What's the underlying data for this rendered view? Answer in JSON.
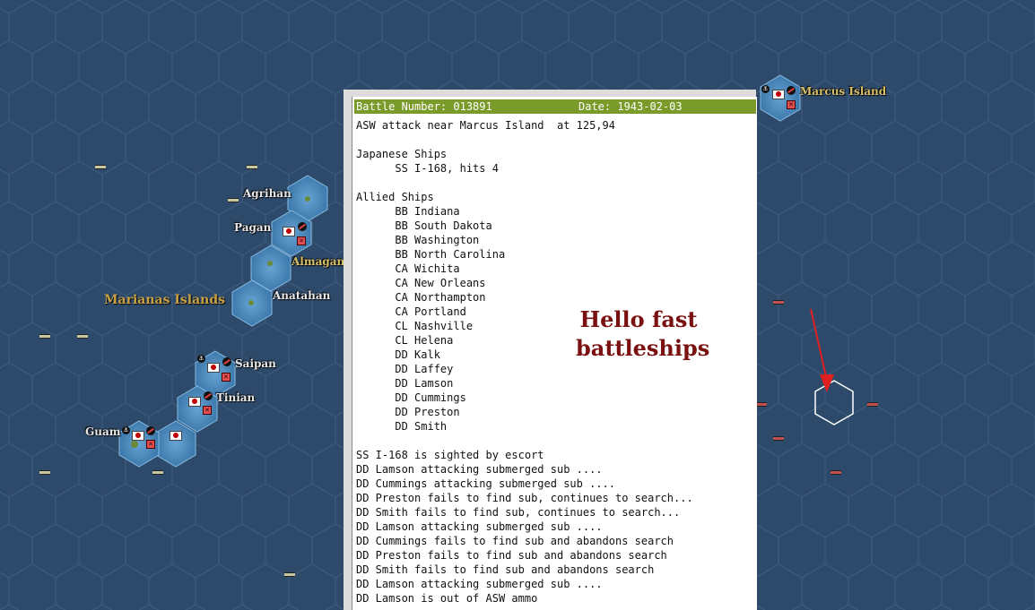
{
  "map": {
    "region_label": "Marianas Islands",
    "places": {
      "marcus": "Marcus Island",
      "agrihan": "Agrihan",
      "pagan": "Pagan",
      "almagan": "Almagan",
      "anatahan": "Anatahan",
      "saipan": "Saipan",
      "tinian": "Tinian",
      "guam": "Guam"
    },
    "colors": {
      "ocean": "#2e4a6b",
      "hex_line": "#3d5a7c",
      "highlight": "#5b98c8",
      "header_bar": "#7a9a2a",
      "annotation": "#7a1010"
    }
  },
  "report": {
    "battle_number": "Battle Number: 013891",
    "date": "Date: 1943-02-03",
    "lines": [
      "ASW attack near Marcus Island  at 125,94",
      "",
      "Japanese Ships",
      "      SS I-168, hits 4",
      "",
      "Allied Ships",
      "      BB Indiana",
      "      BB South Dakota",
      "      BB Washington",
      "      BB North Carolina",
      "      CA Wichita",
      "      CA New Orleans",
      "      CA Northampton",
      "      CA Portland",
      "      CL Nashville",
      "      CL Helena",
      "      DD Kalk",
      "      DD Laffey",
      "      DD Lamson",
      "      DD Cummings",
      "      DD Preston",
      "      DD Smith",
      "",
      "SS I-168 is sighted by escort",
      "DD Lamson attacking submerged sub ....",
      "DD Cummings attacking submerged sub ....",
      "DD Preston fails to find sub, continues to search...",
      "DD Smith fails to find sub, continues to search...",
      "DD Lamson attacking submerged sub ....",
      "DD Cummings fails to find sub and abandons search",
      "DD Preston fails to find sub and abandons search",
      "DD Smith fails to find sub and abandons search",
      "DD Lamson attacking submerged sub ....",
      "DD Lamson is out of ASW ammo"
    ]
  },
  "annotation": {
    "line1": "Hello fast",
    "line2": "battleships"
  }
}
